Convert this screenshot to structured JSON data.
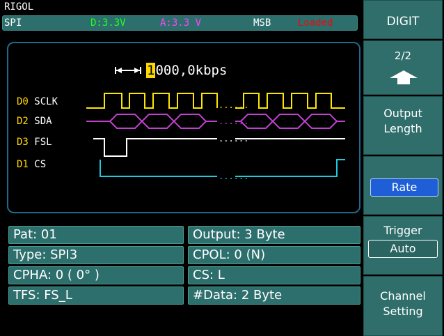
{
  "brand": "RIGOL",
  "status": {
    "mode": "SPI",
    "digital_voltage": "D:3.3V",
    "analog_voltage": "A:3.3 V",
    "bit_order": "MSB",
    "state": "Loaded"
  },
  "waveform": {
    "rate_cursor": "1",
    "rate_rest": "000,0kbps",
    "channels": [
      {
        "id": "D0",
        "name": "SCLK"
      },
      {
        "id": "D2",
        "name": "SDA"
      },
      {
        "id": "D3",
        "name": "FSL"
      },
      {
        "id": "D1",
        "name": "CS"
      }
    ],
    "ellipsis": "......"
  },
  "info": {
    "pat": "Pat:  01",
    "type": "Type:  SPI3",
    "cpha": "CPHA:  0  ( 0° )",
    "tfs": "TFS:  FS_L",
    "output": "Output: 3  Byte",
    "cpol": "CPOL:  0  (N)",
    "cs": "CS:  L",
    "data": "#Data:  2  Byte"
  },
  "menu": {
    "digit": "DIGIT",
    "page": "2/2",
    "output_length_line1": "Output",
    "output_length_line2": "Length",
    "rate": "Rate",
    "trigger": "Trigger",
    "trigger_value": "Auto",
    "channel_line1": "Channel",
    "channel_line2": "Setting"
  },
  "colors": {
    "status_bg": "#2d6f6c",
    "sclk": "#ffe600",
    "sda": "#c040d0",
    "fsl": "#ffffff",
    "cs": "#20c8e0",
    "selected": "#1e5fd8"
  }
}
